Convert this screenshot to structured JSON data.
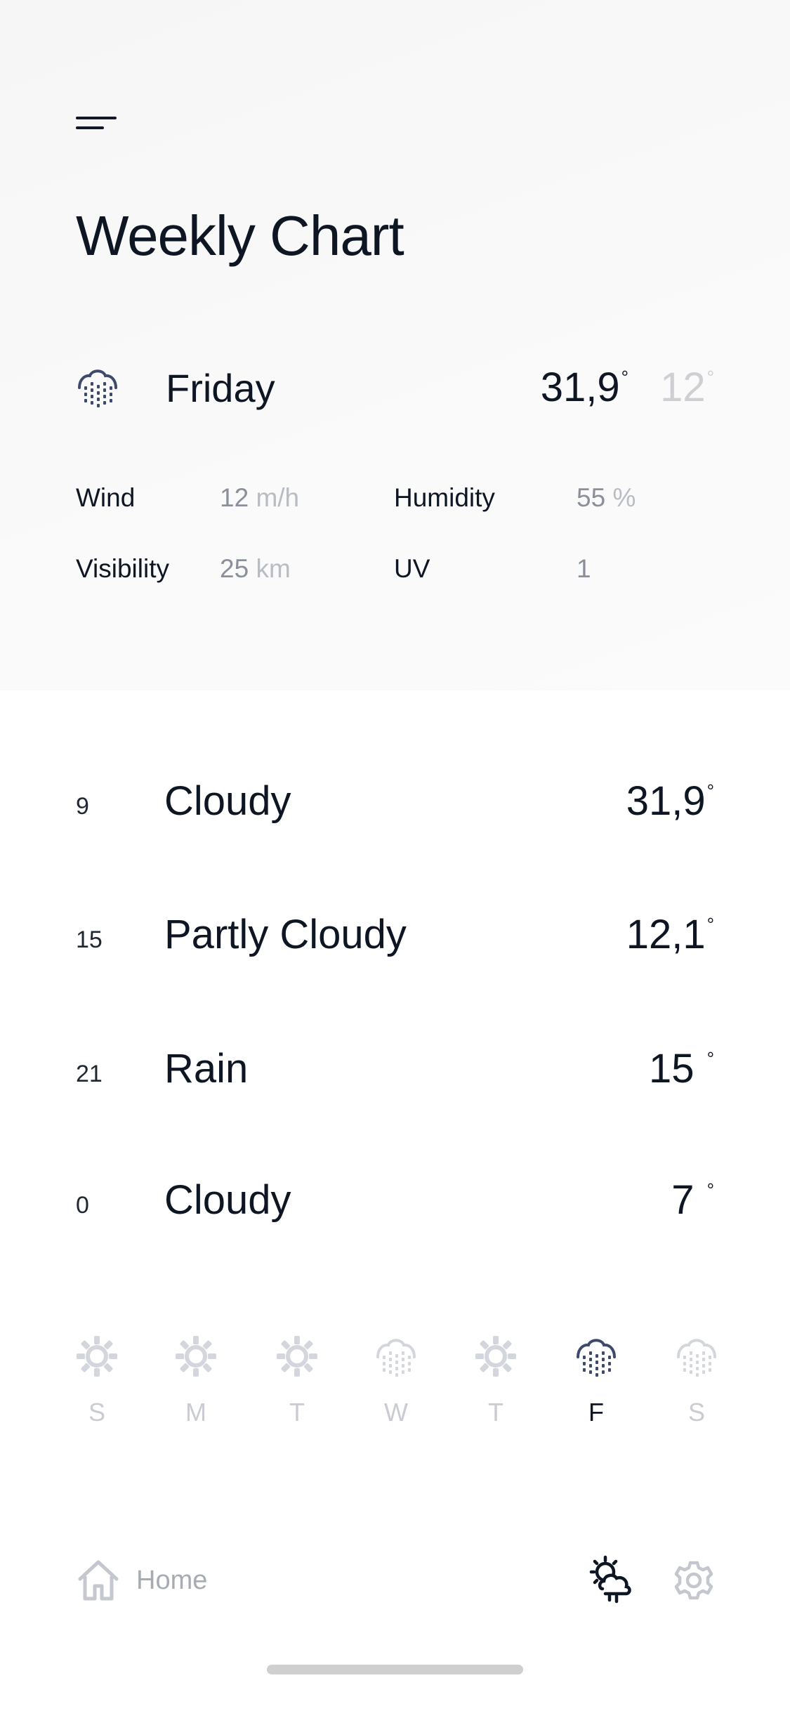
{
  "header": {
    "title": "Weekly Chart"
  },
  "summary": {
    "day": "Friday",
    "icon": "rain-cloud-icon",
    "high": "31,9",
    "low": "12",
    "degree_symbol": "°"
  },
  "stats": {
    "wind_label": "Wind",
    "wind_value": "12",
    "wind_unit": "m/h",
    "humidity_label": "Humidity",
    "humidity_value": "55",
    "humidity_unit": "%",
    "visibility_label": "Visibility",
    "visibility_value": "25",
    "visibility_unit": "km",
    "uv_label": "UV",
    "uv_value": "1"
  },
  "hourly": [
    {
      "hour": "9",
      "condition": "Cloudy",
      "temp": "31,9"
    },
    {
      "hour": "15",
      "condition": "Partly Cloudy",
      "temp": "12,1"
    },
    {
      "hour": "21",
      "condition": "Rain",
      "temp": "15"
    },
    {
      "hour": "0",
      "condition": "Cloudy",
      "temp": "7"
    }
  ],
  "week": [
    {
      "letter": "S",
      "icon": "sun-icon",
      "active": false
    },
    {
      "letter": "M",
      "icon": "sun-icon",
      "active": false
    },
    {
      "letter": "T",
      "icon": "sun-icon",
      "active": false
    },
    {
      "letter": "W",
      "icon": "rain-cloud-icon",
      "active": false
    },
    {
      "letter": "T",
      "icon": "sun-icon",
      "active": false
    },
    {
      "letter": "F",
      "icon": "rain-cloud-icon",
      "active": true
    },
    {
      "letter": "S",
      "icon": "rain-cloud-icon",
      "active": false
    }
  ],
  "nav": {
    "home_label": "Home"
  },
  "colors": {
    "text": "#0f1623",
    "muted": "#8a8f99",
    "icon_active": "#3d4a6b",
    "icon_inactive": "#d3d6dc"
  }
}
